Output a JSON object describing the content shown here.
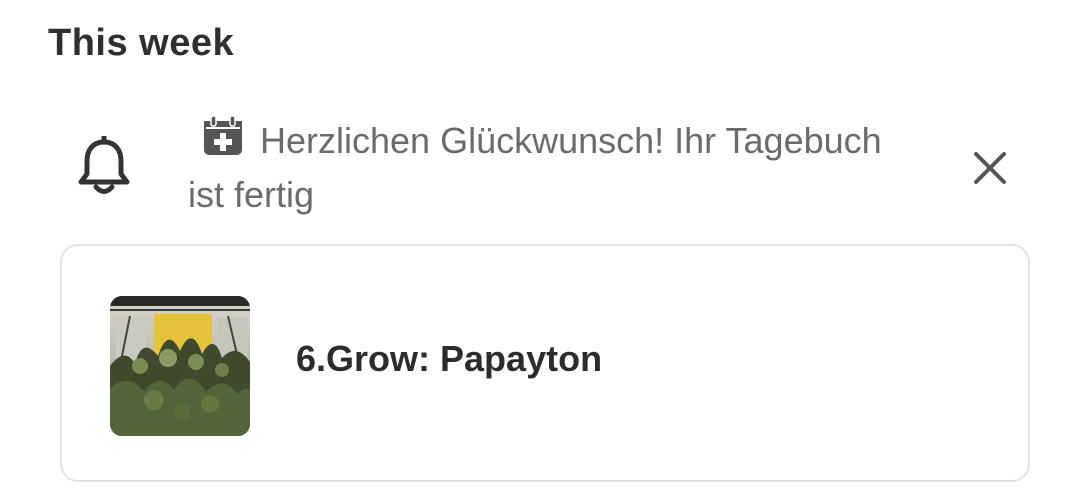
{
  "section": {
    "title": "This week"
  },
  "notification": {
    "bell_icon": "bell-icon",
    "calendar_icon": "calendar-plus-icon",
    "message": "Herzlichen Glückwunsch! Ihr Tagebuch ist fertig",
    "close_icon": "close-icon"
  },
  "card": {
    "thumbnail": "plant-photo",
    "title": "6.Grow: Papayton"
  },
  "colors": {
    "title_text": "#2f2f2f",
    "message_text": "#6b6b6b",
    "card_border": "#e3e3e3",
    "icon_dark": "#333333"
  }
}
